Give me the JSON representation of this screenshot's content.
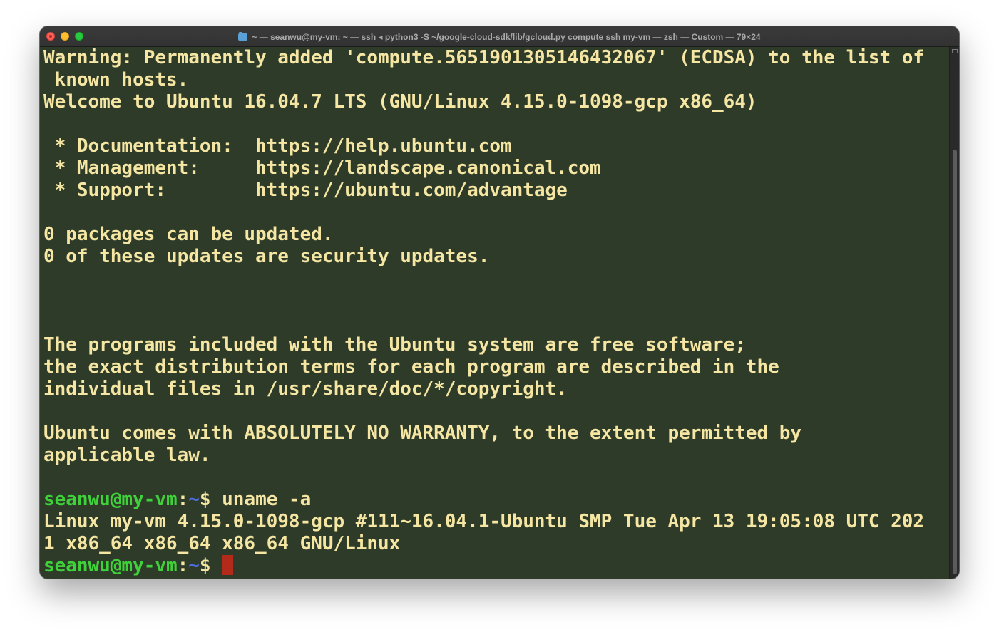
{
  "window": {
    "title": "~ — seanwu@my-vm: ~ — ssh ◂ python3 -S ~/google-cloud-sdk/lib/gcloud.py compute ssh my-vm — zsh — Custom — 79×24"
  },
  "terminal": {
    "lines": [
      "Warning: Permanently added 'compute.5651901305146432067' (ECDSA) to the list of",
      " known hosts.",
      "Welcome to Ubuntu 16.04.7 LTS (GNU/Linux 4.15.0-1098-gcp x86_64)",
      "",
      " * Documentation:  https://help.ubuntu.com",
      " * Management:     https://landscape.canonical.com",
      " * Support:        https://ubuntu.com/advantage",
      "",
      "0 packages can be updated.",
      "0 of these updates are security updates.",
      "",
      "",
      "",
      "The programs included with the Ubuntu system are free software;",
      "the exact distribution terms for each program are described in the",
      "individual files in /usr/share/doc/*/copyright.",
      "",
      "Ubuntu comes with ABSOLUTELY NO WARRANTY, to the extent permitted by",
      "applicable law.",
      ""
    ],
    "prompt": {
      "user_host": "seanwu@my-vm",
      "colon": ":",
      "path": "~",
      "symbol": "$ "
    },
    "command": "uname -a",
    "output": [
      "Linux my-vm 4.15.0-1098-gcp #111~16.04.1-Ubuntu SMP Tue Apr 13 19:05:08 UTC 202",
      "1 x86_64 x86_64 x86_64 GNU/Linux"
    ]
  },
  "colors": {
    "background": "#2e3b29",
    "text": "#f5e6a3",
    "prompt_user": "#3fd13a",
    "prompt_path": "#4f6ee6",
    "cursor": "#b22a1a"
  }
}
